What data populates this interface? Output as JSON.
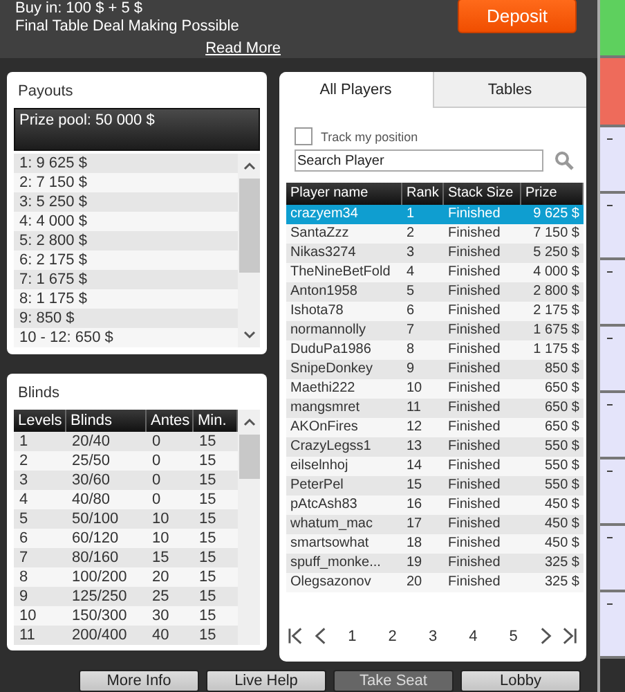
{
  "header": {
    "buy_in": "Buy in: 100 $ + 5 $",
    "note": "Final Table Deal Making Possible",
    "read_more": "Read More",
    "deposit": "Deposit"
  },
  "payouts": {
    "title": "Payouts",
    "prize_pool": "Prize pool: 50 000 $",
    "items": [
      "1: 9 625 $",
      "2: 7 150 $",
      "3: 5 250 $",
      "4: 4 000 $",
      "5: 2 800 $",
      "6: 2 175 $",
      "7: 1 675 $",
      "8: 1 175 $",
      "9: 850 $",
      "10 - 12: 650 $"
    ]
  },
  "blinds": {
    "title": "Blinds",
    "columns": [
      "Levels",
      "Blinds",
      "Antes",
      "Min."
    ],
    "rows": [
      [
        "1",
        "20/40",
        "0",
        "15"
      ],
      [
        "2",
        "25/50",
        "0",
        "15"
      ],
      [
        "3",
        "30/60",
        "0",
        "15"
      ],
      [
        "4",
        "40/80",
        "0",
        "15"
      ],
      [
        "5",
        "50/100",
        "10",
        "15"
      ],
      [
        "6",
        "60/120",
        "10",
        "15"
      ],
      [
        "7",
        "80/160",
        "15",
        "15"
      ],
      [
        "8",
        "100/200",
        "20",
        "15"
      ],
      [
        "9",
        "125/250",
        "25",
        "15"
      ],
      [
        "10",
        "150/300",
        "30",
        "15"
      ],
      [
        "11",
        "200/400",
        "40",
        "15"
      ]
    ]
  },
  "tabs": [
    {
      "label": "All Players",
      "selected": true
    },
    {
      "label": "Tables",
      "selected": false
    }
  ],
  "track": {
    "label": "Track my position",
    "checked": false
  },
  "search": {
    "placeholder": "Search Player"
  },
  "players": {
    "columns": [
      "Player name",
      "Rank",
      "Stack Size",
      "Prize"
    ],
    "rows": [
      {
        "cells": [
          "crazyem34",
          "1",
          "Finished",
          "9 625 $"
        ],
        "selected": true
      },
      {
        "cells": [
          "SantaZzz",
          "2",
          "Finished",
          "7 150 $"
        ],
        "selected": false
      },
      {
        "cells": [
          "Nikas3274",
          "3",
          "Finished",
          "5 250 $"
        ],
        "selected": false
      },
      {
        "cells": [
          "TheNineBetFold",
          "4",
          "Finished",
          "4 000 $"
        ],
        "selected": false
      },
      {
        "cells": [
          "Anton1958",
          "5",
          "Finished",
          "2 800 $"
        ],
        "selected": false
      },
      {
        "cells": [
          "Ishota78",
          "6",
          "Finished",
          "2 175 $"
        ],
        "selected": false
      },
      {
        "cells": [
          "normannolly",
          "7",
          "Finished",
          "1 675 $"
        ],
        "selected": false
      },
      {
        "cells": [
          "DuduPa1986",
          "8",
          "Finished",
          "1 175 $"
        ],
        "selected": false
      },
      {
        "cells": [
          "SnipeDonkey",
          "9",
          "Finished",
          "850 $"
        ],
        "selected": false
      },
      {
        "cells": [
          "Maethi222",
          "10",
          "Finished",
          "650 $"
        ],
        "selected": false
      },
      {
        "cells": [
          "mangsmret",
          "11",
          "Finished",
          "650 $"
        ],
        "selected": false
      },
      {
        "cells": [
          "AKOnFires",
          "12",
          "Finished",
          "650 $"
        ],
        "selected": false
      },
      {
        "cells": [
          "CrazyLegss1",
          "13",
          "Finished",
          "550 $"
        ],
        "selected": false
      },
      {
        "cells": [
          "eilselnhoj",
          "14",
          "Finished",
          "550 $"
        ],
        "selected": false
      },
      {
        "cells": [
          "PeterPel",
          "15",
          "Finished",
          "550 $"
        ],
        "selected": false
      },
      {
        "cells": [
          "pAtcAsh83",
          "16",
          "Finished",
          "450 $"
        ],
        "selected": false
      },
      {
        "cells": [
          "whatum_mac",
          "17",
          "Finished",
          "450 $"
        ],
        "selected": false
      },
      {
        "cells": [
          "smartsowhat",
          "18",
          "Finished",
          "450 $"
        ],
        "selected": false
      },
      {
        "cells": [
          "spuff_monke...",
          "19",
          "Finished",
          "325 $"
        ],
        "selected": false
      },
      {
        "cells": [
          "Olegsazonov",
          "20",
          "Finished",
          "325 $"
        ],
        "selected": false
      }
    ]
  },
  "pages": [
    "1",
    "2",
    "3",
    "4",
    "5"
  ],
  "buttons": [
    {
      "label": "More Info",
      "disabled": false
    },
    {
      "label": "Live Help",
      "disabled": false
    },
    {
      "label": "Take Seat",
      "disabled": true
    },
    {
      "label": "Lobby",
      "disabled": false
    }
  ]
}
